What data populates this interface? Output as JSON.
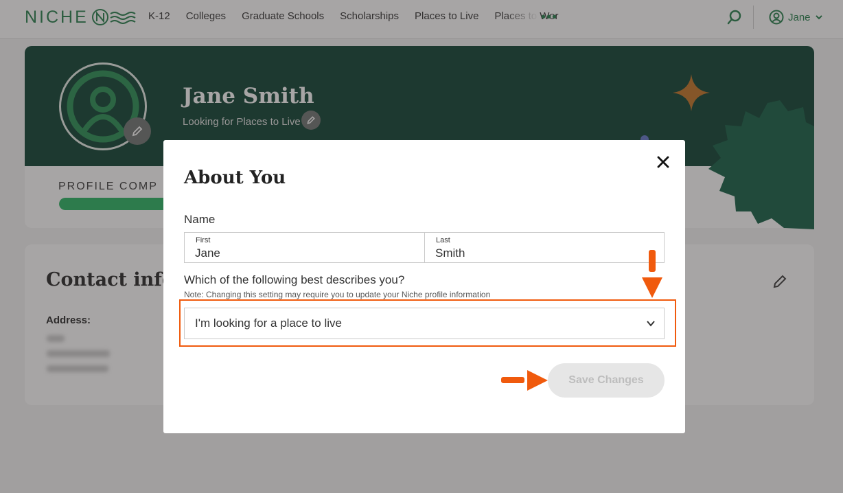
{
  "nav": {
    "logo_text": "NICHE",
    "links": [
      "K-12",
      "Colleges",
      "Graduate Schools",
      "Scholarships",
      "Places to Live",
      "Places to Wor"
    ],
    "more_label": "•••",
    "user_name": "Jane"
  },
  "profile": {
    "name": "Jane Smith",
    "subtitle": "Looking for Places to Live",
    "completion_label": "PROFILE COMP",
    "completion_fraction": 0.25
  },
  "contact": {
    "title": "Contact info",
    "address_label": "Address:"
  },
  "modal": {
    "title": "About You",
    "name_label": "Name",
    "first_label": "First",
    "first_value": "Jane",
    "last_label": "Last",
    "last_value": "Smith",
    "question": "Which of the following best describes you?",
    "note": "Note: Changing this setting may require you to update your Niche profile information",
    "selected_option": "I'm looking for a place to live",
    "save_label": "Save Changes"
  },
  "colors": {
    "brand_green": "#1e7b45",
    "banner": "#053b2b",
    "annotation": "#f05a0d"
  }
}
